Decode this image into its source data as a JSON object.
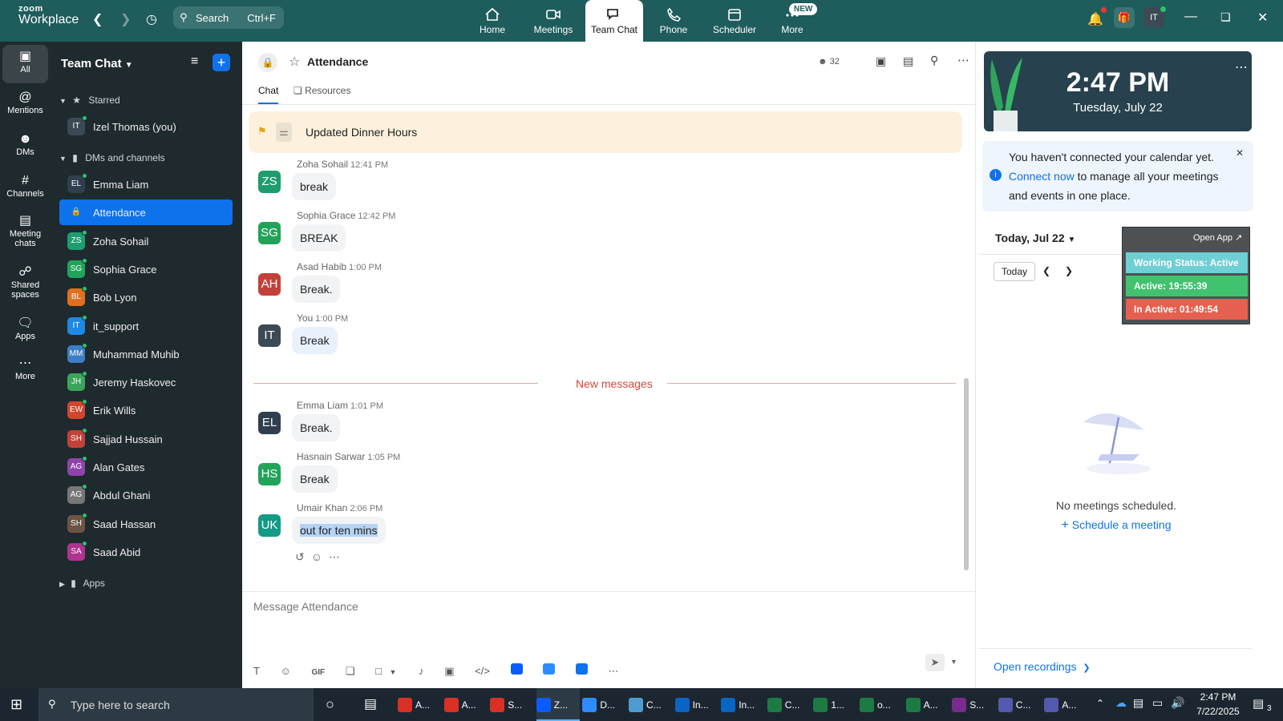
{
  "topbar": {
    "logo_small": "zoom",
    "logo_big": "Workplace",
    "search_label": "Search",
    "search_shortcut": "Ctrl+F",
    "tabs": [
      {
        "label": "Home",
        "icon": "home-icon"
      },
      {
        "label": "Meetings",
        "icon": "video-icon"
      },
      {
        "label": "Team Chat",
        "icon": "chat-icon"
      },
      {
        "label": "Phone",
        "icon": "phone-icon"
      },
      {
        "label": "Scheduler",
        "icon": "calendar-icon"
      },
      {
        "label": "More",
        "icon": "more-icon"
      }
    ],
    "new_badge": "NEW",
    "avatar_initials": "IT"
  },
  "rail": [
    {
      "label": "All"
    },
    {
      "label": "Mentions"
    },
    {
      "label": "DMs"
    },
    {
      "label": "Channels"
    },
    {
      "label": "Meeting chats"
    },
    {
      "label": "Shared spaces"
    },
    {
      "label": "Apps"
    },
    {
      "label": "More"
    }
  ],
  "sidebar": {
    "title": "Team Chat",
    "starred_label": "Starred",
    "dms_label": "DMs and channels",
    "apps_label": "Apps",
    "starred": [
      {
        "initials": "IT",
        "name": "Izel Thomas (you)",
        "color": "#3b4a55"
      }
    ],
    "items": [
      {
        "initials": "EL",
        "name": "Emma Liam",
        "color": "#2f3f4d"
      },
      {
        "initials": "",
        "name": "Attendance",
        "color": "#0e72ed"
      },
      {
        "initials": "ZS",
        "name": "Zoha Sohail",
        "color": "#1f9d6e"
      },
      {
        "initials": "SG",
        "name": "Sophia Grace",
        "color": "#22a35a"
      },
      {
        "initials": "BL",
        "name": "Bob Lyon",
        "color": "#e0701f"
      },
      {
        "initials": "IT",
        "name": "it_support",
        "color": "#1e88e5"
      },
      {
        "initials": "MM",
        "name": "Muhammad Muhib",
        "color": "#3c7ec5"
      },
      {
        "initials": "JH",
        "name": "Jeremy Haskovec",
        "color": "#3aa55b"
      },
      {
        "initials": "EW",
        "name": "Erik Wills",
        "color": "#d2452f"
      },
      {
        "initials": "SH",
        "name": "Sajjad Hussain",
        "color": "#c2423b"
      },
      {
        "initials": "AG",
        "name": "Alan Gates",
        "color": "#8d44ad"
      },
      {
        "initials": "AG",
        "name": "Abdul Ghani",
        "color": "#777777"
      },
      {
        "initials": "SH",
        "name": "Saad Hassan",
        "color": "#6b5544"
      },
      {
        "initials": "SA",
        "name": "Saad Abid",
        "color": "#b0338e"
      }
    ]
  },
  "channel": {
    "name": "Attendance",
    "member_count": "32",
    "tab_chat": "Chat",
    "tab_resources": "Resources",
    "pinned": "Updated Dinner Hours",
    "new_messages": "New messages",
    "input_placeholder": "Message Attendance"
  },
  "messages": [
    {
      "initials": "ZS",
      "color": "#1f9d6e",
      "sender": "Zoha Sohail",
      "time": "12:41 PM",
      "text": "break"
    },
    {
      "initials": "SG",
      "color": "#22a35a",
      "sender": "Sophia Grace",
      "time": "12:42 PM",
      "text": "BREAK"
    },
    {
      "initials": "AH",
      "color": "#c2423b",
      "sender": "Asad Habib",
      "time": "1:00 PM",
      "text": "Break."
    },
    {
      "initials": "IT",
      "color": "#3b4a55",
      "sender": "You",
      "time": "1:00 PM",
      "text": "Break"
    },
    {
      "initials": "EL",
      "color": "#2f3f4d",
      "sender": "Emma Liam",
      "time": "1:01 PM",
      "text": "Break."
    },
    {
      "initials": "HS",
      "color": "#22a35a",
      "sender": "Hasnain Sarwar",
      "time": "1:05 PM",
      "text": "Break"
    },
    {
      "initials": "UK",
      "color": "#149a87",
      "sender": "Umair Khan",
      "time": "2:06 PM",
      "text": "out for ten mins"
    }
  ],
  "composer_tools": [
    "text-format-icon",
    "emoji-icon",
    "GIF",
    "file-icon",
    "screenshot-icon",
    "mic-icon",
    "video-clip-icon",
    "code-icon",
    "app1-icon",
    "app2-icon",
    "app3-icon",
    "more-icon"
  ],
  "right": {
    "time": "2:47 PM",
    "date": "Tuesday, July 22",
    "notice_part1": "You haven't connected your calendar yet.",
    "notice_link": "Connect now",
    "notice_part2": "to manage all your meetings and events in one place.",
    "day_label": "Today, Jul 22",
    "today_btn": "Today",
    "open_app": "Open App ↗",
    "working_status": "Working Status: Active",
    "active": "Active: 19:55:39",
    "inactive": "In Active: 01:49:54",
    "no_meetings": "No meetings scheduled.",
    "schedule_link": "Schedule a meeting",
    "open_recordings": "Open recordings"
  },
  "taskbar": {
    "search_placeholder": "Type here to search",
    "apps": [
      {
        "label": "A...",
        "color": "#d93025"
      },
      {
        "label": "A...",
        "color": "#d93025"
      },
      {
        "label": "S...",
        "color": "#d93025"
      },
      {
        "label": "Z...",
        "color": "#0b5cff"
      },
      {
        "label": "D...",
        "color": "#2d8cff"
      },
      {
        "label": "C...",
        "color": "#4e9bd1"
      },
      {
        "label": "In...",
        "color": "#0a64c2"
      },
      {
        "label": "In...",
        "color": "#0a64c2"
      },
      {
        "label": "C...",
        "color": "#1d7a42"
      },
      {
        "label": "1...",
        "color": "#1d7a42"
      },
      {
        "label": "o...",
        "color": "#1d7a42"
      },
      {
        "label": "A...",
        "color": "#1d7a42"
      },
      {
        "label": "S...",
        "color": "#7a2b8f"
      },
      {
        "label": "C...",
        "color": "#5558af"
      },
      {
        "label": "A...",
        "color": "#5558af"
      }
    ],
    "clock_time": "2:47 PM",
    "clock_date": "7/22/2025",
    "notif_count": "3"
  }
}
